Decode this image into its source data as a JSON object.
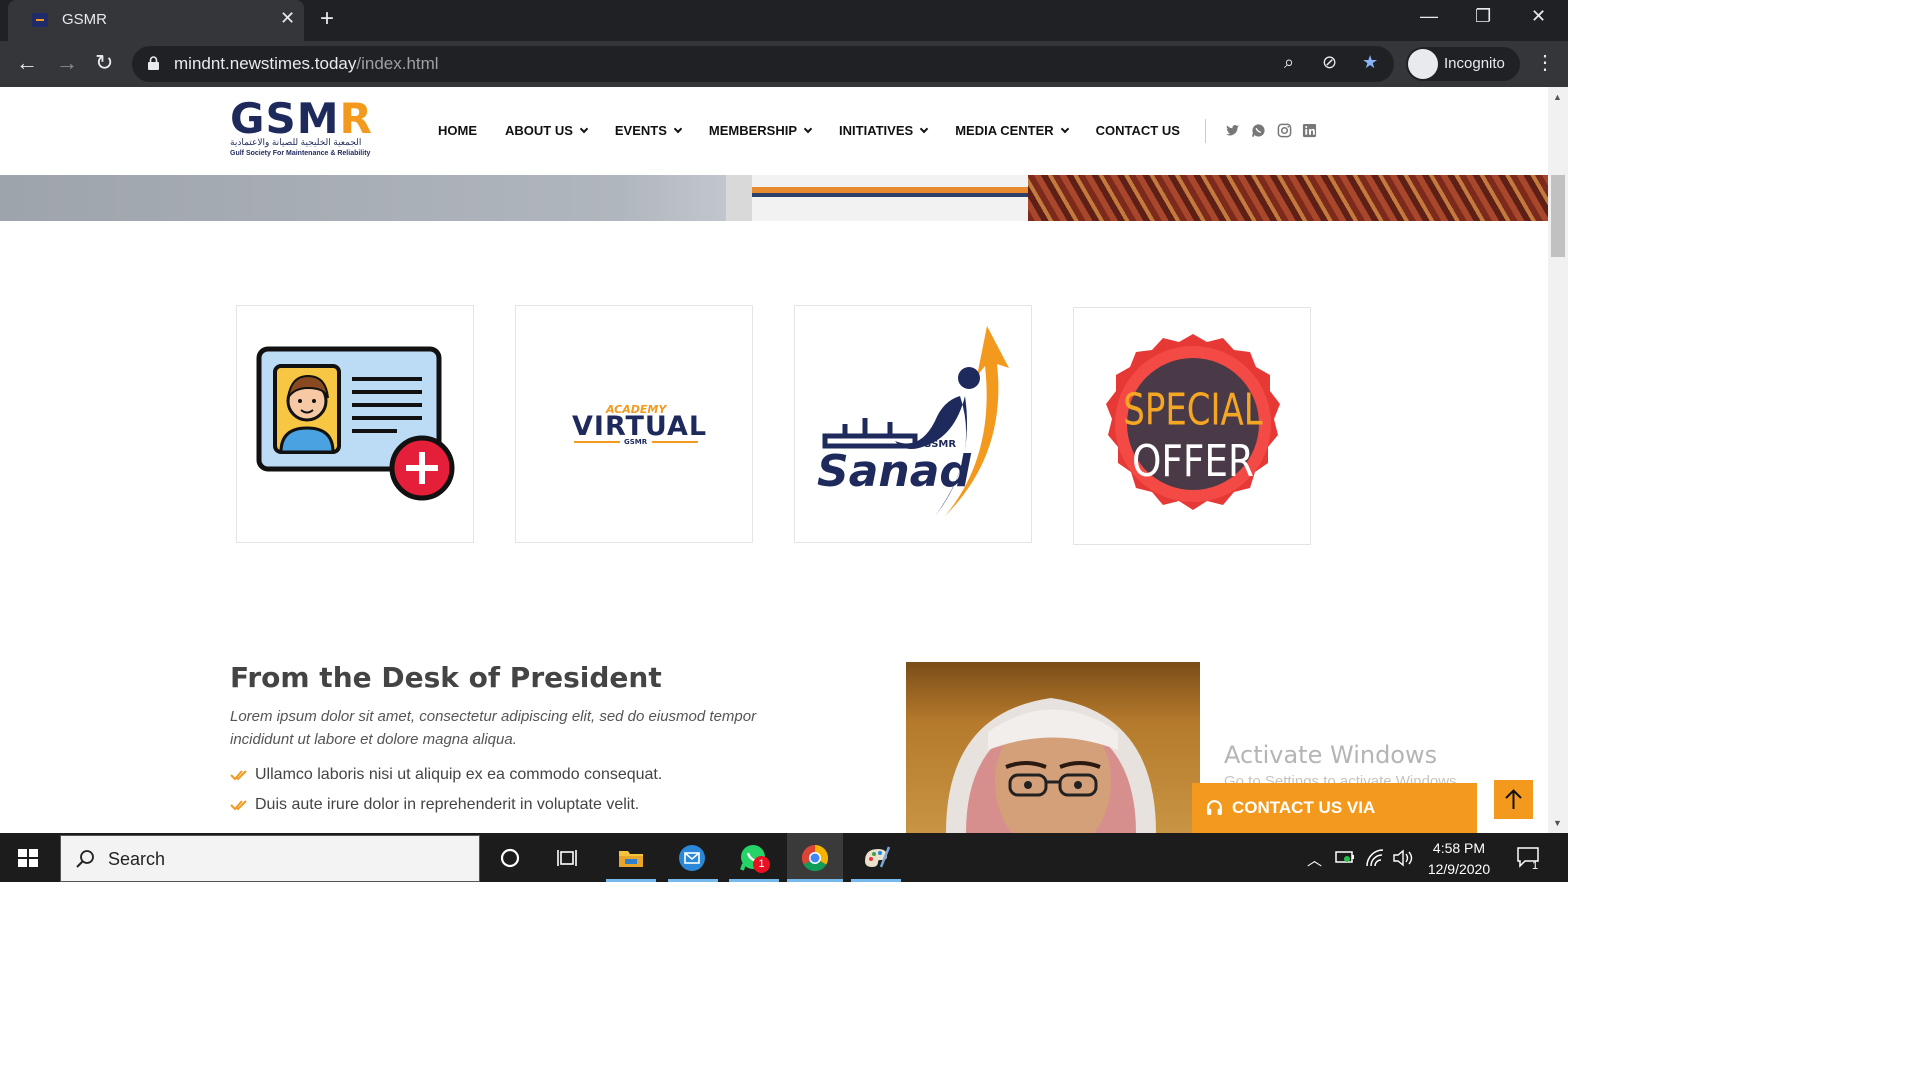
{
  "browser": {
    "tab_title": "GSMR",
    "url_host": "mindnt.newstimes.today",
    "url_path": "/index.html",
    "profile_label": "Incognito"
  },
  "site": {
    "logo_text_main": "GSM",
    "logo_text_accent": "R",
    "logo_arabic": "الجمعية الخليجية للصيانة والاعتمادية",
    "logo_english": "Gulf Society For Maintenance & Reliability",
    "nav": [
      {
        "label": "HOME",
        "dropdown": false
      },
      {
        "label": "ABOUT US",
        "dropdown": true
      },
      {
        "label": "EVENTS",
        "dropdown": true
      },
      {
        "label": "MEMBERSHIP",
        "dropdown": true
      },
      {
        "label": "INITIATIVES",
        "dropdown": true
      },
      {
        "label": "MEDIA CENTER",
        "dropdown": true
      },
      {
        "label": "CONTACT US",
        "dropdown": false
      }
    ],
    "social_icons": [
      "twitter-icon",
      "whatsapp-icon",
      "instagram-icon",
      "linkedin-icon"
    ]
  },
  "cards": [
    {
      "icon": "id-card-add-icon"
    },
    {
      "icon": "virtual-academy-logo",
      "text_top": "ACADEMY",
      "text_main": "VIRTUAL",
      "text_sub": "GSMR"
    },
    {
      "icon": "sanad-logo",
      "text_main": "Sanad",
      "text_sub": "GSMR"
    },
    {
      "icon": "special-offer-badge",
      "line1": "SPECIAL",
      "line2": "OFFER"
    }
  ],
  "president": {
    "title": "From the Desk of President",
    "intro": "Lorem ipsum dolor sit amet, consectetur adipiscing elit, sed do eiusmod tempor incididunt ut labore et dolore magna aliqua.",
    "items": [
      "Ullamco laboris nisi ut aliquip ex ea commodo consequat.",
      "Duis aute irure dolor in reprehenderit in voluptate velit."
    ]
  },
  "watermark": {
    "title": "Activate Windows",
    "subtitle": "Go to Settings to activate Windows."
  },
  "contact_via": {
    "label": "CONTACT US VIA"
  },
  "colors": {
    "brand_navy": "#1f2a5c",
    "brand_orange": "#f39a1e"
  },
  "taskbar": {
    "search_label": "Search",
    "time": "4:58 PM",
    "date": "12/9/2020",
    "whatsapp_badge": "1",
    "notification_badge": "1"
  }
}
